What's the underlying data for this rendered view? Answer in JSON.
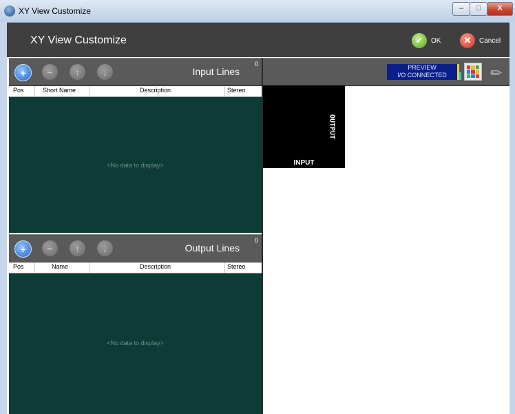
{
  "window": {
    "title": "XY View Customize",
    "controls": {
      "minimize": "–",
      "maximize": "□",
      "close": "X"
    }
  },
  "header": {
    "title": "XY View Customize",
    "ok_label": "OK",
    "cancel_label": "Cancel",
    "ok_glyph": "✓",
    "cancel_glyph": "✕"
  },
  "input_panel": {
    "label": "Input Lines",
    "count": "0",
    "buttons": {
      "add": "+",
      "remove": "−",
      "up": "↑",
      "down": "↓"
    },
    "columns": [
      "Pos",
      "Short Name",
      "Description",
      "Stereo"
    ],
    "empty_text": "<No data to display>"
  },
  "output_panel": {
    "label": "Output Lines",
    "count": "0",
    "buttons": {
      "add": "+",
      "remove": "−",
      "up": "↑",
      "down": "↓"
    },
    "columns": [
      "Pos",
      "Name",
      "Description",
      "Stereo"
    ],
    "empty_text": "<No data to display>"
  },
  "preview": {
    "line1": "PREVIEW",
    "line2": "I/O CONNECTED",
    "canvas_output_label": "OUTPUT",
    "canvas_input_label": "INPUT"
  },
  "icons": {
    "grid_icon_colors": [
      "#e23b2e",
      "#f2c318",
      "#3cb44b",
      "#2a7fd4",
      "#e23b2e",
      "#f2c318",
      "#3cb44b",
      "#2a7fd4",
      "#e23b2e"
    ]
  },
  "colors": {
    "grid_background": "#0d3b35",
    "toolbar": "#5a5a5a",
    "header": "#3f3f3f",
    "preview_box": "#0a1f8a"
  }
}
